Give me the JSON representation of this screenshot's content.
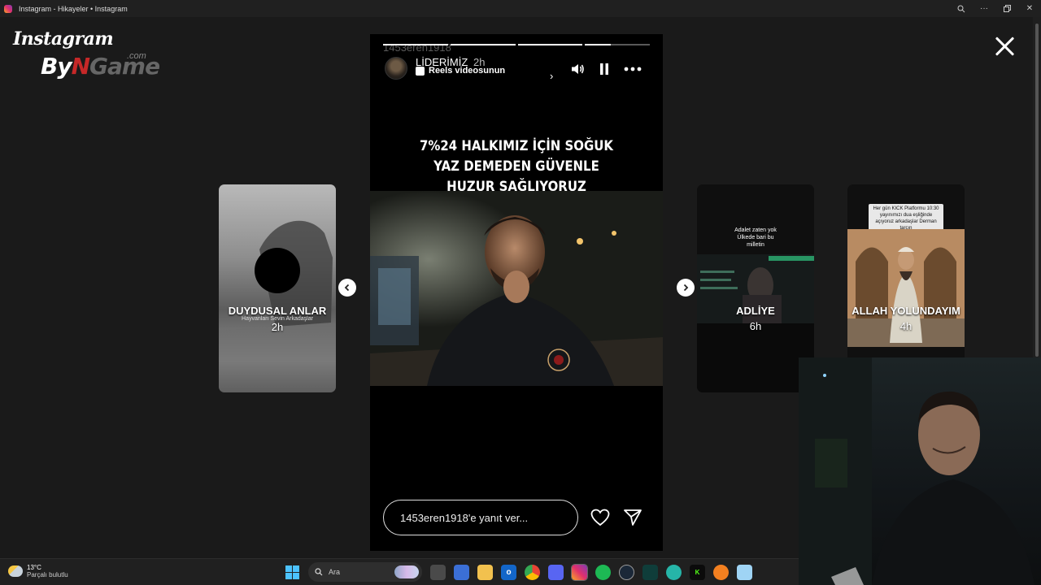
{
  "window": {
    "title": "Instagram - Hikayeler • Instagram",
    "controls": [
      "zoom-icon",
      "more-icon",
      "restore-icon",
      "close-icon"
    ]
  },
  "logo": {
    "line1": "Instagram",
    "line2_part1": "By",
    "line2_accent": "N",
    "line2_part2": "Game",
    "suffix": ".com"
  },
  "stories": {
    "left": {
      "name": "DUYDUSAL ANLAR",
      "subtitle": "Hayvanları Sevin Arkadaşlar",
      "time": "2h"
    },
    "current": {
      "ghost_username": "1453eren1918",
      "username": "LİDERİMİZ",
      "time": "2h",
      "reels_label": "Reels videosunun",
      "headline": "7%24 HALKIMIZ İÇİN SOĞUK YAZ DEMEDEN GÜVENLE HUZUR SAĞLIYORUZ",
      "progress": [
        1,
        1,
        1,
        0.4
      ],
      "reply_placeholder": "1453eren1918'e yanıt ver..."
    },
    "right1": {
      "name": "ADLİYE",
      "time": "6h",
      "caption": "Adalet zaten yok Ülkede bari bu milletin"
    },
    "right2": {
      "name": "ALLAH YOLUNDAYIM",
      "time": "4h",
      "caption": "Her gün KICK Platformu 10:30 yayınımızı dua eşliğinde açıyoruz arkadaşlar Derman tarçın"
    }
  },
  "taskbar": {
    "weather_temp": "13°C",
    "weather_desc": "Parçalı bulutlu",
    "search_placeholder": "Ara"
  },
  "colors": {
    "background": "#1a1a1a",
    "story_bg": "#000000",
    "logo_accent": "#c62828"
  }
}
